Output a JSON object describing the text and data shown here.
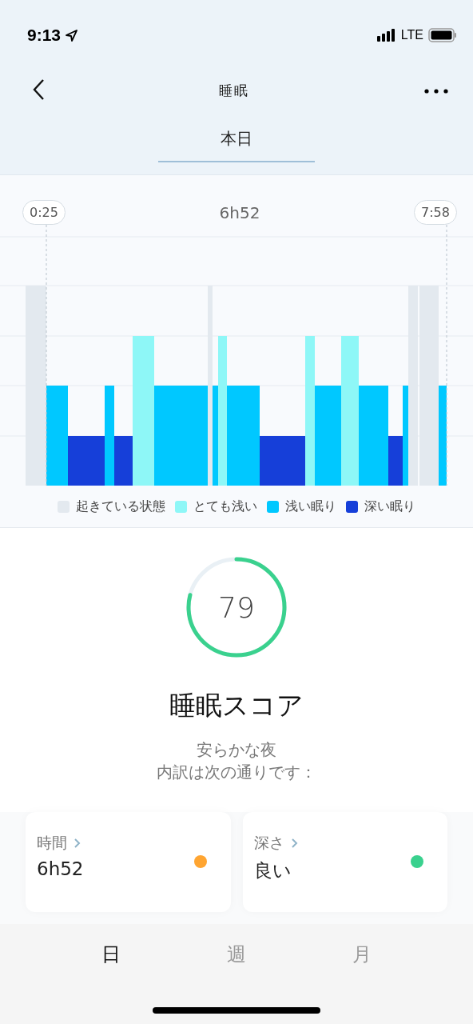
{
  "status_bar": {
    "time": "9:13",
    "network": "LTE"
  },
  "nav": {
    "title": "睡眠"
  },
  "tabs": [
    {
      "label": "本日",
      "selected": true
    }
  ],
  "chart": {
    "start": "0:25",
    "duration": "6h52",
    "end": "7:58",
    "legend": [
      {
        "label": "起きている状態",
        "color": "#e3e9ef"
      },
      {
        "label": "とても浅い",
        "color": "#8ef7f7"
      },
      {
        "label": "浅い眠り",
        "color": "#00c8ff"
      },
      {
        "label": "深い眠り",
        "color": "#163fd9"
      }
    ]
  },
  "score": {
    "value": "79",
    "title": "睡眠スコア",
    "lines": [
      "安らかな夜",
      "内訳は次の通りです："
    ]
  },
  "cards": [
    {
      "label": "時間",
      "value": "6h52",
      "color": "#ffa531"
    },
    {
      "label": "深さ",
      "value": "良い",
      "color": "#3ad18e"
    }
  ],
  "bottom_tabs": [
    {
      "label": "日",
      "selected": true
    },
    {
      "label": "週",
      "selected": false
    },
    {
      "label": "月",
      "selected": false
    }
  ]
}
